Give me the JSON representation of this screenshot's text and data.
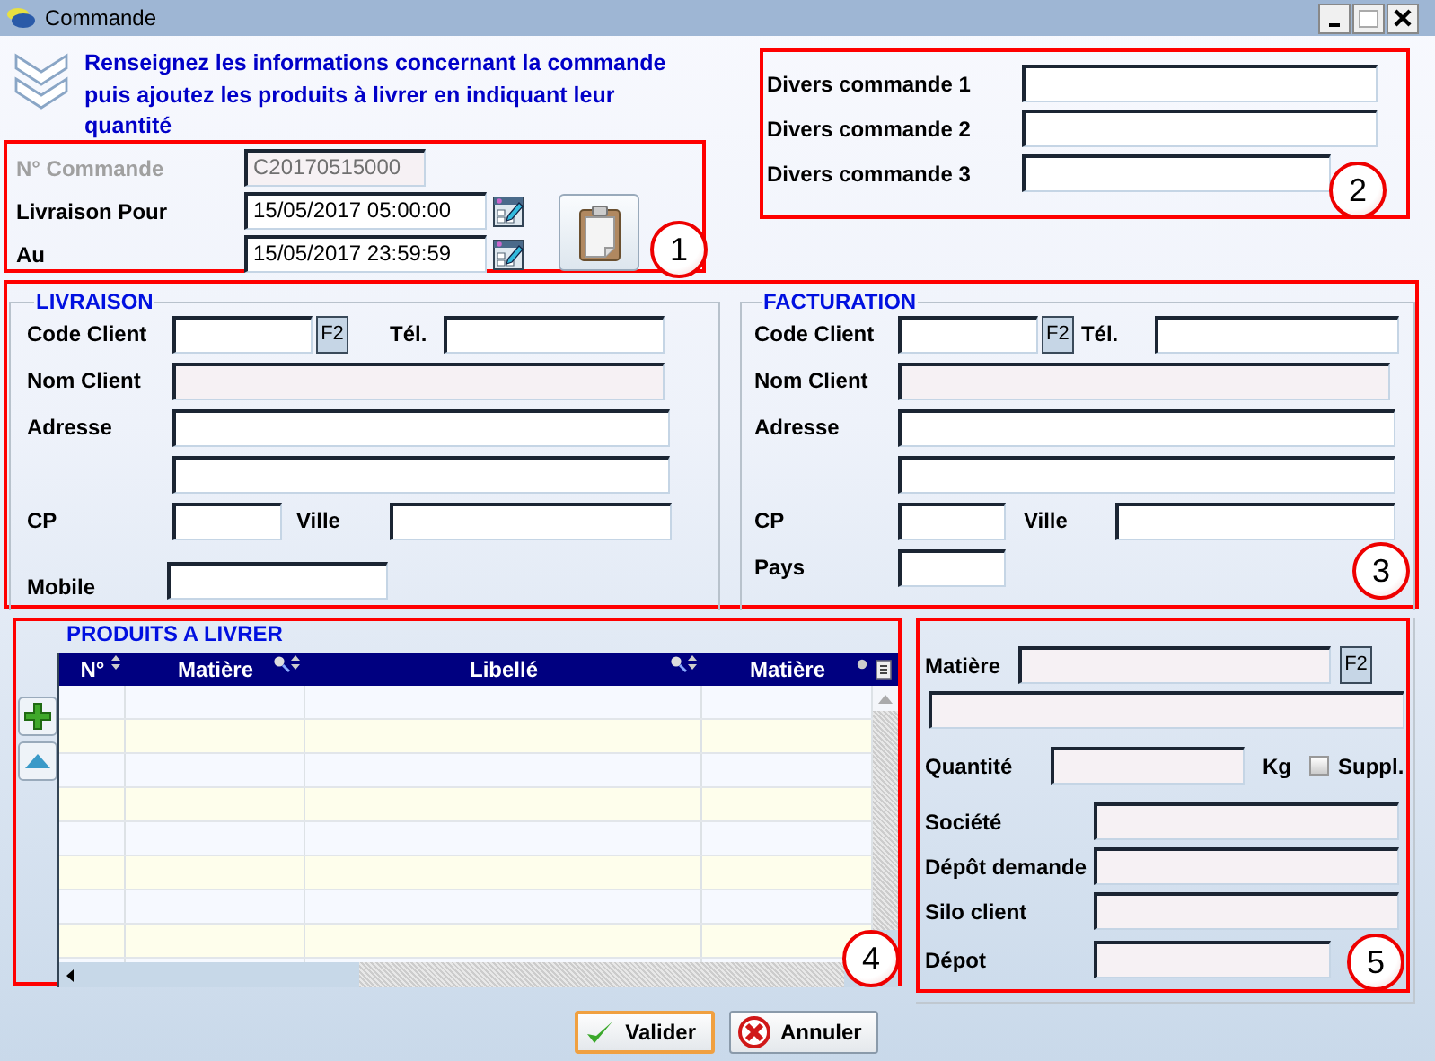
{
  "window": {
    "title": "Commande"
  },
  "intro": "Renseignez les informations concernant la commande puis ajoutez les produits à livrer en indiquant leur quantité",
  "order": {
    "callout": "1",
    "fields": [
      {
        "label": "N° Commande",
        "kind": "text",
        "value": "C20170515000",
        "disabled": true
      },
      {
        "label": "Livraison Pour",
        "kind": "datetime",
        "value": "15/05/2017 05:00:00",
        "disabled": false
      },
      {
        "label": "Au",
        "kind": "datetime",
        "value": "15/05/2017 23:59:59",
        "disabled": false
      }
    ]
  },
  "misc": {
    "callout": "2",
    "fields": [
      {
        "label": "Divers commande 1"
      },
      {
        "label": "Divers commande 2"
      },
      {
        "label": "Divers commande 3"
      }
    ]
  },
  "client": {
    "callout": "3",
    "sections": [
      {
        "title": "LIVRAISON",
        "code_label": "Code Client",
        "lookup": "F2",
        "phone_label": "Tél.",
        "name_label": "Nom Client",
        "name_disabled": true,
        "address_label": "Adresse",
        "postcode_label": "CP",
        "city_label": "Ville",
        "extra_label": "Mobile"
      },
      {
        "title": "FACTURATION",
        "code_label": "Code Client",
        "lookup": "F2",
        "phone_label": "Tél.",
        "name_label": "Nom Client",
        "name_disabled": true,
        "address_label": "Adresse",
        "postcode_label": "CP",
        "city_label": "Ville",
        "extra_label": "Pays"
      }
    ]
  },
  "products": {
    "title": "PRODUITS A LIVRER",
    "callout": "4",
    "columns": [
      {
        "label": "N°",
        "sortable": true,
        "searchable": false,
        "pinned": false
      },
      {
        "label": "Matière",
        "sortable": true,
        "searchable": true,
        "pinned": false
      },
      {
        "label": "Libellé",
        "sortable": true,
        "searchable": true,
        "pinned": false
      },
      {
        "label": "Matière",
        "sortable": false,
        "searchable": false,
        "pinned": true
      }
    ]
  },
  "detail": {
    "callout": "5",
    "disabled": true,
    "material_label": "Matière",
    "lookup": "F2",
    "quantity_label": "Quantité",
    "unit": "Kg",
    "supplement": {
      "label": "Suppl.",
      "checked": false
    },
    "fields": [
      {
        "label": "Société"
      },
      {
        "label": "Dépôt demande"
      },
      {
        "label": "Silo client"
      },
      {
        "label": "Dépot"
      }
    ]
  },
  "buttons": [
    {
      "label": "Valider",
      "kind": "confirm",
      "default": true
    },
    {
      "label": "Annuler",
      "kind": "cancel",
      "default": false
    }
  ]
}
